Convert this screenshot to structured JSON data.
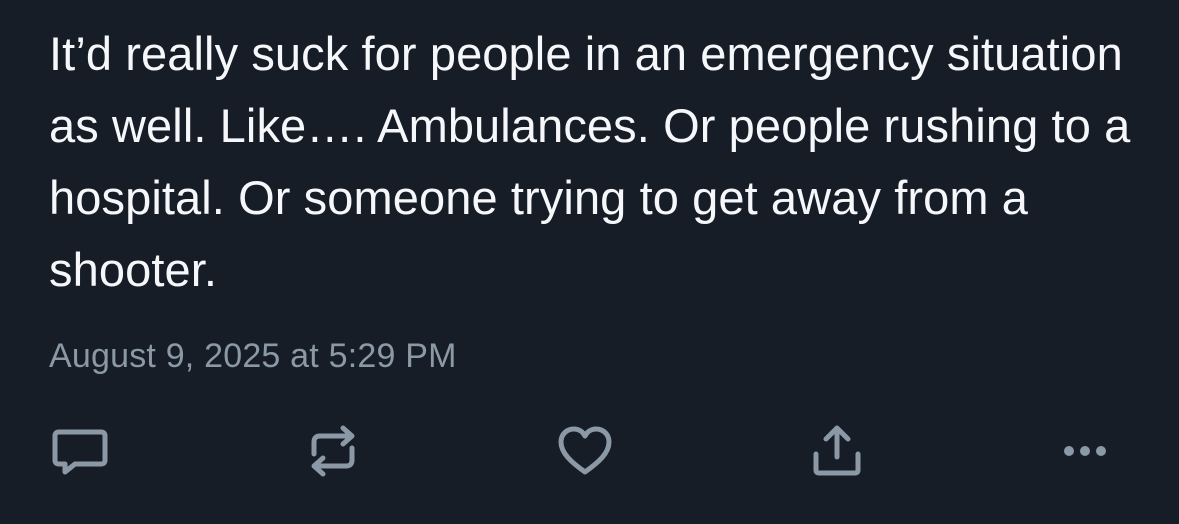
{
  "post": {
    "text": "It’d really suck for people in an emergency situation as well. Like…. Ambulances. Or people rushing to a hospital. Or someone trying to get away from a shooter.",
    "timestamp": "August 9, 2025 at 5:29 PM"
  },
  "actions": [
    {
      "name": "reply",
      "icon": "reply-icon"
    },
    {
      "name": "repost",
      "icon": "repost-icon"
    },
    {
      "name": "like",
      "icon": "heart-icon"
    },
    {
      "name": "share",
      "icon": "share-icon"
    },
    {
      "name": "more",
      "icon": "more-icon"
    }
  ],
  "colors": {
    "background": "#171d27",
    "text": "#f5f7fa",
    "muted": "#8b98a5"
  }
}
